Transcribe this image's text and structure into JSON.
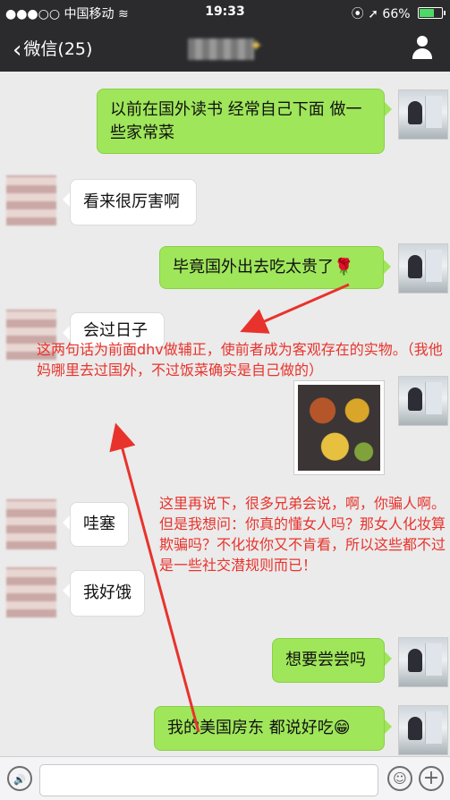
{
  "status_bar": {
    "signal": "●●●○○",
    "carrier": "中国移动",
    "wifi_icon": "wifi-icon",
    "time": "19:33",
    "lock_icon": "⦿",
    "location_icon": "➚",
    "battery_percent": "66%",
    "battery_level": 0.66
  },
  "nav": {
    "back_label": "微信(25)",
    "back_icon": "‹",
    "title_blurred": true
  },
  "messages": [
    {
      "side": "out",
      "text": "以前在国外读书 经常自己下面 做一些家常菜"
    },
    {
      "side": "in",
      "text": "看来很厉害啊"
    },
    {
      "side": "out",
      "text": "毕竟国外出去吃太贵了🌹"
    },
    {
      "side": "in",
      "text": "会过日子"
    },
    {
      "side": "out",
      "type": "image",
      "description": "home-cooked dishes photo"
    },
    {
      "side": "in",
      "text": "哇塞"
    },
    {
      "side": "in",
      "text": "我好饿"
    },
    {
      "side": "out",
      "text": "想要尝尝吗"
    },
    {
      "side": "out",
      "text": "我的美国房东 都说好吃😁"
    }
  ],
  "annotations": [
    "这两句话为前面dhv做辅正，使前者成为客观存在的实物。（我他妈哪里去过国外，不过饭菜确实是自己做的）",
    "这里再说下，很多兄弟会说，啊，你骗人啊。但是我想问：你真的懂女人吗？那女人化妆算欺骗吗？不化妆你又不肯看，所以这些都不过是一些社交潜规则而已！"
  ],
  "annotation_color": "#e8332c",
  "input_bar": {
    "voice_icon": "🔊",
    "emoji_icon": "☺",
    "plus_icon": "+"
  },
  "colors": {
    "bar": "#2b2b2e",
    "out_bubble": "#9fe65a",
    "in_bubble": "#ffffff",
    "background": "#ebebeb"
  }
}
